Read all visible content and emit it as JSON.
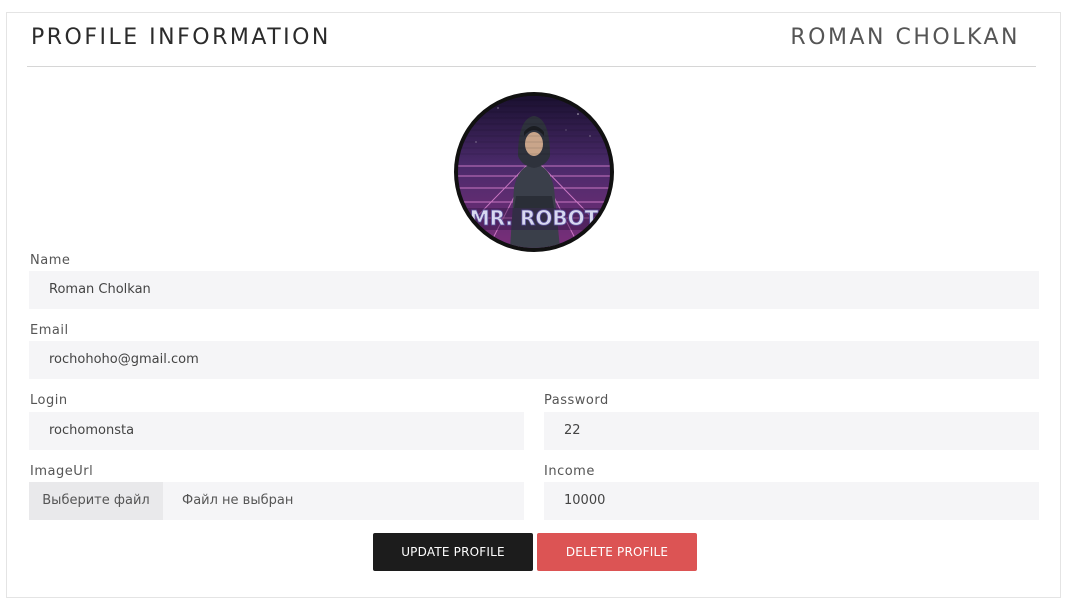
{
  "header": {
    "title": "PROFILE INFORMATION",
    "user_name": "ROMAN CHOLKAN"
  },
  "avatar": {
    "caption": "MR. ROBOT",
    "icon": "avatar-image"
  },
  "form": {
    "name": {
      "label": "Name",
      "value": "Roman Cholkan"
    },
    "email": {
      "label": "Email",
      "value": "rochohoho@gmail.com"
    },
    "login": {
      "label": "Login",
      "value": "rochomonsta"
    },
    "password": {
      "label": "Password",
      "value": "22"
    },
    "image_url": {
      "label": "ImageUrl",
      "button": "Выберите файл",
      "status": "Файл не выбран"
    },
    "income": {
      "label": "Income",
      "value": "10000"
    }
  },
  "actions": {
    "update_label": "UPDATE PROFILE",
    "delete_label": "DELETE PROFILE"
  },
  "colors": {
    "update_bg": "#1c1c1c",
    "delete_bg": "#dc5454",
    "field_bg": "#f5f5f7"
  }
}
